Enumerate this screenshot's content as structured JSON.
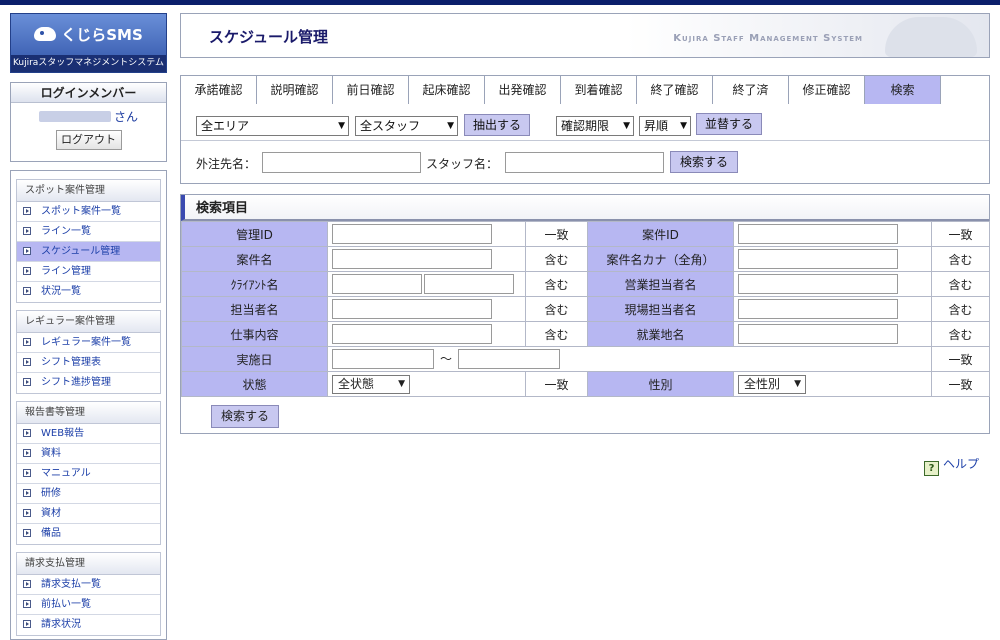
{
  "sidebar": {
    "logo_text": "くじらSMS",
    "logo_subtitle": "Kujiraスタッフマネジメントシステム",
    "login": {
      "title": "ログインメンバー",
      "name_suffix": "さん",
      "logout_label": "ログアウト"
    },
    "groups": [
      {
        "title": "スポット案件管理",
        "items": [
          "スポット案件一覧",
          "ライン一覧",
          "スケジュール管理",
          "ライン管理",
          "状況一覧"
        ],
        "active_index": 2
      },
      {
        "title": "レギュラー案件管理",
        "items": [
          "レギュラー案件一覧",
          "シフト管理表",
          "シフト進捗管理"
        ]
      },
      {
        "title": "報告書等管理",
        "items": [
          "WEB報告",
          "資料",
          "マニュアル",
          "研修",
          "資材",
          "備品"
        ]
      },
      {
        "title": "請求支払管理",
        "items": [
          "請求支払一覧",
          "前払い一覧",
          "請求状況"
        ]
      }
    ]
  },
  "header": {
    "title": "スケジュール管理",
    "system_name": "Kujira Staff Management System"
  },
  "tabs": {
    "items": [
      "承諾確認",
      "説明確認",
      "前日確認",
      "起床確認",
      "出発確認",
      "到着確認",
      "終了確認",
      "終了済",
      "修正確認",
      "検索"
    ],
    "active": "検索"
  },
  "filters": {
    "area_select": "全エリア",
    "staff_select": "全スタッフ",
    "extract_button": "抽出する",
    "sort_key_select": "確認期限",
    "sort_order_select": "昇順",
    "sort_button": "並替する",
    "client_label": "外注先名：",
    "client_value": "",
    "staff_label": "スタッフ名：",
    "staff_value": "",
    "search_button": "検索する"
  },
  "search_panel": {
    "title": "検索項目",
    "rows": {
      "manage_id": "管理ID",
      "project_id": "案件ID",
      "project_name": "案件名",
      "project_name_kana": "案件名カナ（全角）",
      "client_name": "ｸﾗｲｱﾝﾄ名",
      "sales_person": "営業担当者名",
      "person_in_charge": "担当者名",
      "site_person": "現場担当者名",
      "work_content": "仕事内容",
      "work_location": "就業地名",
      "date": "実施日",
      "status": "状態",
      "gender": "性別"
    },
    "match_exact": "一致",
    "match_contains": "含む",
    "date_separator": "〜",
    "status_select": "全状態",
    "gender_select": "全性別",
    "search_button": "検索する"
  },
  "help_label": "ヘルプ",
  "colors": {
    "accent": "#b7b7f2",
    "top_bar": "#0b1f6b",
    "link": "#1c3fa8"
  }
}
